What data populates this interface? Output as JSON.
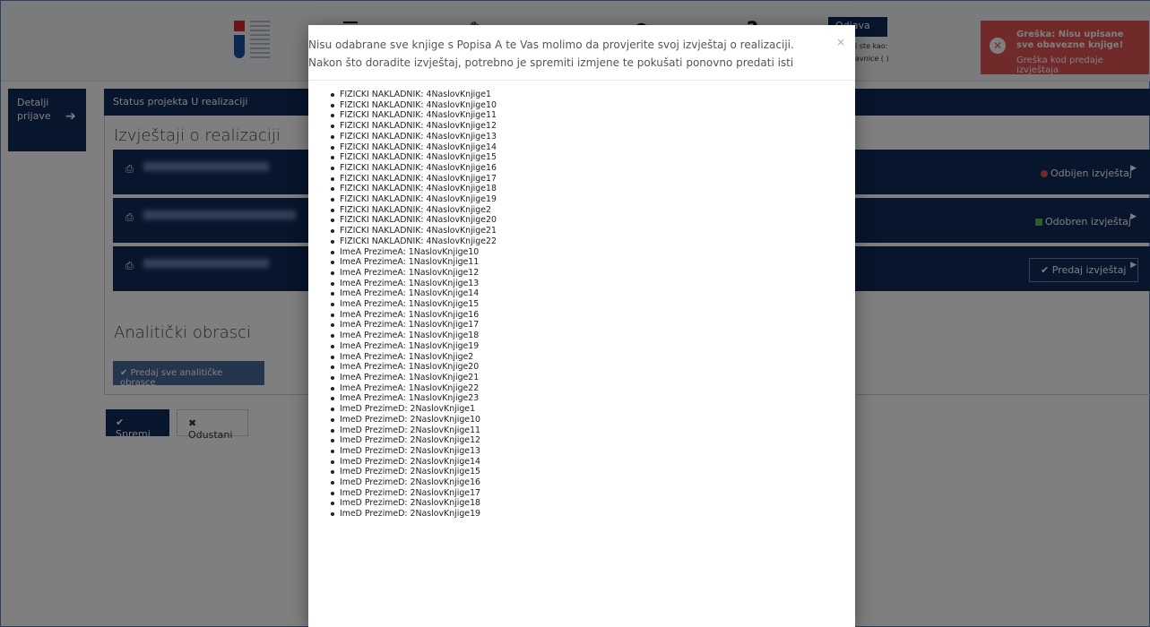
{
  "header": {
    "logout_label": "Odjava",
    "user_line_1": "i ste kao:",
    "user_line_2": "avnice (                )"
  },
  "toast": {
    "title": "Greška: Nisu upisane sve obavezne knjige!",
    "message": "Greška kod predaje izvještaja",
    "color": "#e05454"
  },
  "sidebar": {
    "tab_label": "Detalji prijave"
  },
  "status_bar": {
    "label": "Status projekta U realizaciji"
  },
  "reports": {
    "title": "Izvještaji o realizaciji",
    "rows": [
      {
        "status_label": "Odbijen izvještaj",
        "status_color": "#d9534f"
      },
      {
        "status_label": "Odobren izvještaj",
        "status_color": "#5cb85c"
      },
      {
        "status_label": "Predaj izvještaj"
      }
    ]
  },
  "analytic": {
    "title": "Analitički obrasci",
    "submit_all_label": "Predaj sve analitičke obrasce"
  },
  "form_actions": {
    "save_label": "Spremi",
    "cancel_label": "Odustani"
  },
  "modal": {
    "message": "Nisu odabrane sve knjige s Popisa A te Vas molimo da provjerite svoj izvještaj o realizaciji. Nakon što doradite izvještaj, potrebno je spremiti izmjene te pokušati ponovno predati isti",
    "close_glyph": "×",
    "items": [
      "FIZICKI NAKLADNIK: 4NaslovKnjige1",
      "FIZICKI NAKLADNIK: 4NaslovKnjige10",
      "FIZICKI NAKLADNIK: 4NaslovKnjige11",
      "FIZICKI NAKLADNIK: 4NaslovKnjige12",
      "FIZICKI NAKLADNIK: 4NaslovKnjige13",
      "FIZICKI NAKLADNIK: 4NaslovKnjige14",
      "FIZICKI NAKLADNIK: 4NaslovKnjige15",
      "FIZICKI NAKLADNIK: 4NaslovKnjige16",
      "FIZICKI NAKLADNIK: 4NaslovKnjige17",
      "FIZICKI NAKLADNIK: 4NaslovKnjige18",
      "FIZICKI NAKLADNIK: 4NaslovKnjige19",
      "FIZICKI NAKLADNIK: 4NaslovKnjige2",
      "FIZICKI NAKLADNIK: 4NaslovKnjige20",
      "FIZICKI NAKLADNIK: 4NaslovKnjige21",
      "FIZICKI NAKLADNIK: 4NaslovKnjige22",
      "ImeA PrezimeA: 1NaslovKnjige10",
      "ImeA PrezimeA: 1NaslovKnjige11",
      "ImeA PrezimeA: 1NaslovKnjige12",
      "ImeA PrezimeA: 1NaslovKnjige13",
      "ImeA PrezimeA: 1NaslovKnjige14",
      "ImeA PrezimeA: 1NaslovKnjige15",
      "ImeA PrezimeA: 1NaslovKnjige16",
      "ImeA PrezimeA: 1NaslovKnjige17",
      "ImeA PrezimeA: 1NaslovKnjige18",
      "ImeA PrezimeA: 1NaslovKnjige19",
      "ImeA PrezimeA: 1NaslovKnjige2",
      "ImeA PrezimeA: 1NaslovKnjige20",
      "ImeA PrezimeA: 1NaslovKnjige21",
      "ImeA PrezimeA: 1NaslovKnjige22",
      "ImeA PrezimeA: 1NaslovKnjige23",
      "ImeD PrezimeD: 2NaslovKnjige1",
      "ImeD PrezimeD: 2NaslovKnjige10",
      "ImeD PrezimeD: 2NaslovKnjige11",
      "ImeD PrezimeD: 2NaslovKnjige12",
      "ImeD PrezimeD: 2NaslovKnjige13",
      "ImeD PrezimeD: 2NaslovKnjige14",
      "ImeD PrezimeD: 2NaslovKnjige15",
      "ImeD PrezimeD: 2NaslovKnjige16",
      "ImeD PrezimeD: 2NaslovKnjige17",
      "ImeD PrezimeD: 2NaslovKnjige18",
      "ImeD PrezimeD: 2NaslovKnjige19"
    ]
  }
}
